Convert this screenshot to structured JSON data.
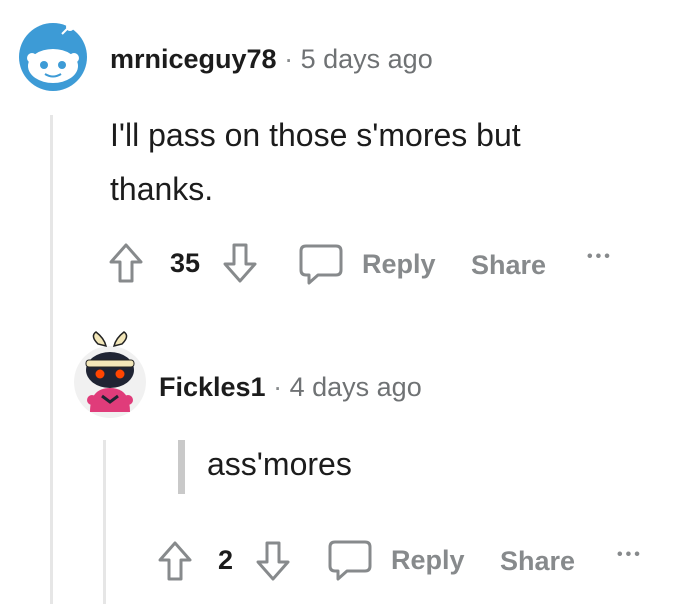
{
  "comment1": {
    "username": "mrniceguy78",
    "separator": "·",
    "time": "5 days ago",
    "text": "I'll pass on those s'mores but thanks.",
    "votes": "35",
    "reply_label": "Reply",
    "share_label": "Share",
    "more_label": "•••",
    "avatar_icon": "snoo-default-avatar-icon"
  },
  "comment2": {
    "username": "Fickles1",
    "separator": "·",
    "time": "4 days ago",
    "quote_text": "ass'mores",
    "votes": "2",
    "reply_label": "Reply",
    "share_label": "Share",
    "more_label": "•••",
    "avatar_icon": "snoo-ninja-avatar-icon"
  },
  "colors": {
    "accent_blue": "#3d9bd6",
    "meta_gray": "#878a8c",
    "thread_line": "#e6e6e6",
    "quote_bar": "#c9c9c9"
  }
}
